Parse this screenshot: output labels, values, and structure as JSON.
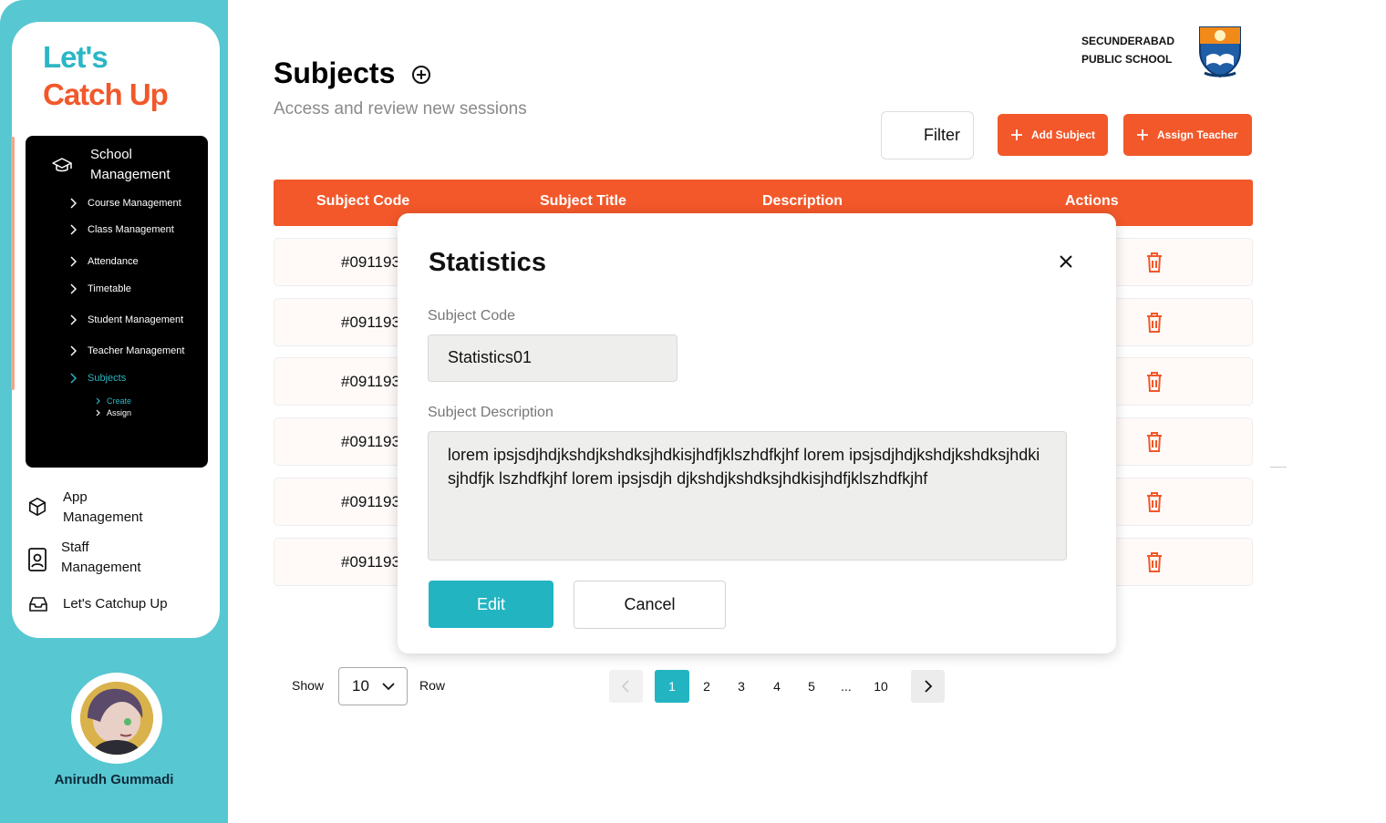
{
  "brand": {
    "line1": "Let's",
    "line2": "Catch Up"
  },
  "sidebar": {
    "school_management": "School Management",
    "sub_items": [
      {
        "label": "Course Management"
      },
      {
        "label": "Class Management"
      },
      {
        "label": "Attendance"
      },
      {
        "label": "Timetable"
      },
      {
        "label": "Student Management"
      },
      {
        "label": "Teacher Management"
      },
      {
        "label": "Subjects"
      }
    ],
    "subjects_children": [
      {
        "label": "Create"
      },
      {
        "label": "Assign"
      }
    ],
    "nav": [
      {
        "label": "App Management",
        "icon": "box-icon"
      },
      {
        "label": "Staff Management",
        "icon": "badge-icon"
      },
      {
        "label": "Let's Catchup Up",
        "icon": "inbox-icon"
      }
    ],
    "user_name": "Anirudh Gummadi"
  },
  "header": {
    "title": "Subjects",
    "subtitle": "Access and review new sessions",
    "school_name_line1": "SECUNDERABAD",
    "school_name_line2": "PUBLIC SCHOOL",
    "filter_label": "Filter",
    "add_subject_label": "Add Subject",
    "assign_teacher_label": "Assign Teacher"
  },
  "table": {
    "columns": [
      "Subject Code",
      "Subject Title",
      "Description",
      "Actions"
    ],
    "rows": [
      {
        "code": "#091193"
      },
      {
        "code": "#091193"
      },
      {
        "code": "#091193"
      },
      {
        "code": "#091193"
      },
      {
        "code": "#091193"
      },
      {
        "code": "#091193"
      }
    ]
  },
  "pagination": {
    "show_label": "Show",
    "rows_value": "10",
    "row_label": "Row",
    "pages": [
      "1",
      "2",
      "3",
      "4",
      "5",
      "...",
      "10"
    ],
    "current": "1"
  },
  "modal": {
    "title": "Statistics",
    "code_label": "Subject Code",
    "code_value": "Statistics01",
    "desc_label": "Subject Description",
    "desc_value": "lorem ipsjsdjhdjkshdjkshdksjhdkisjhdfjklszhdfkjhf lorem ipsjsdjhdjkshdjkshdksjhdkisjhdfjk lszhdfkjhf lorem ipsjsdjh djkshdjkshdksjhdkisjhdfjklszhdfkjhf",
    "edit_label": "Edit",
    "cancel_label": "Cancel"
  },
  "colors": {
    "accent_orange": "#f2582a",
    "accent_teal": "#23b4c2",
    "sidebar_bg": "#57c7d1"
  }
}
